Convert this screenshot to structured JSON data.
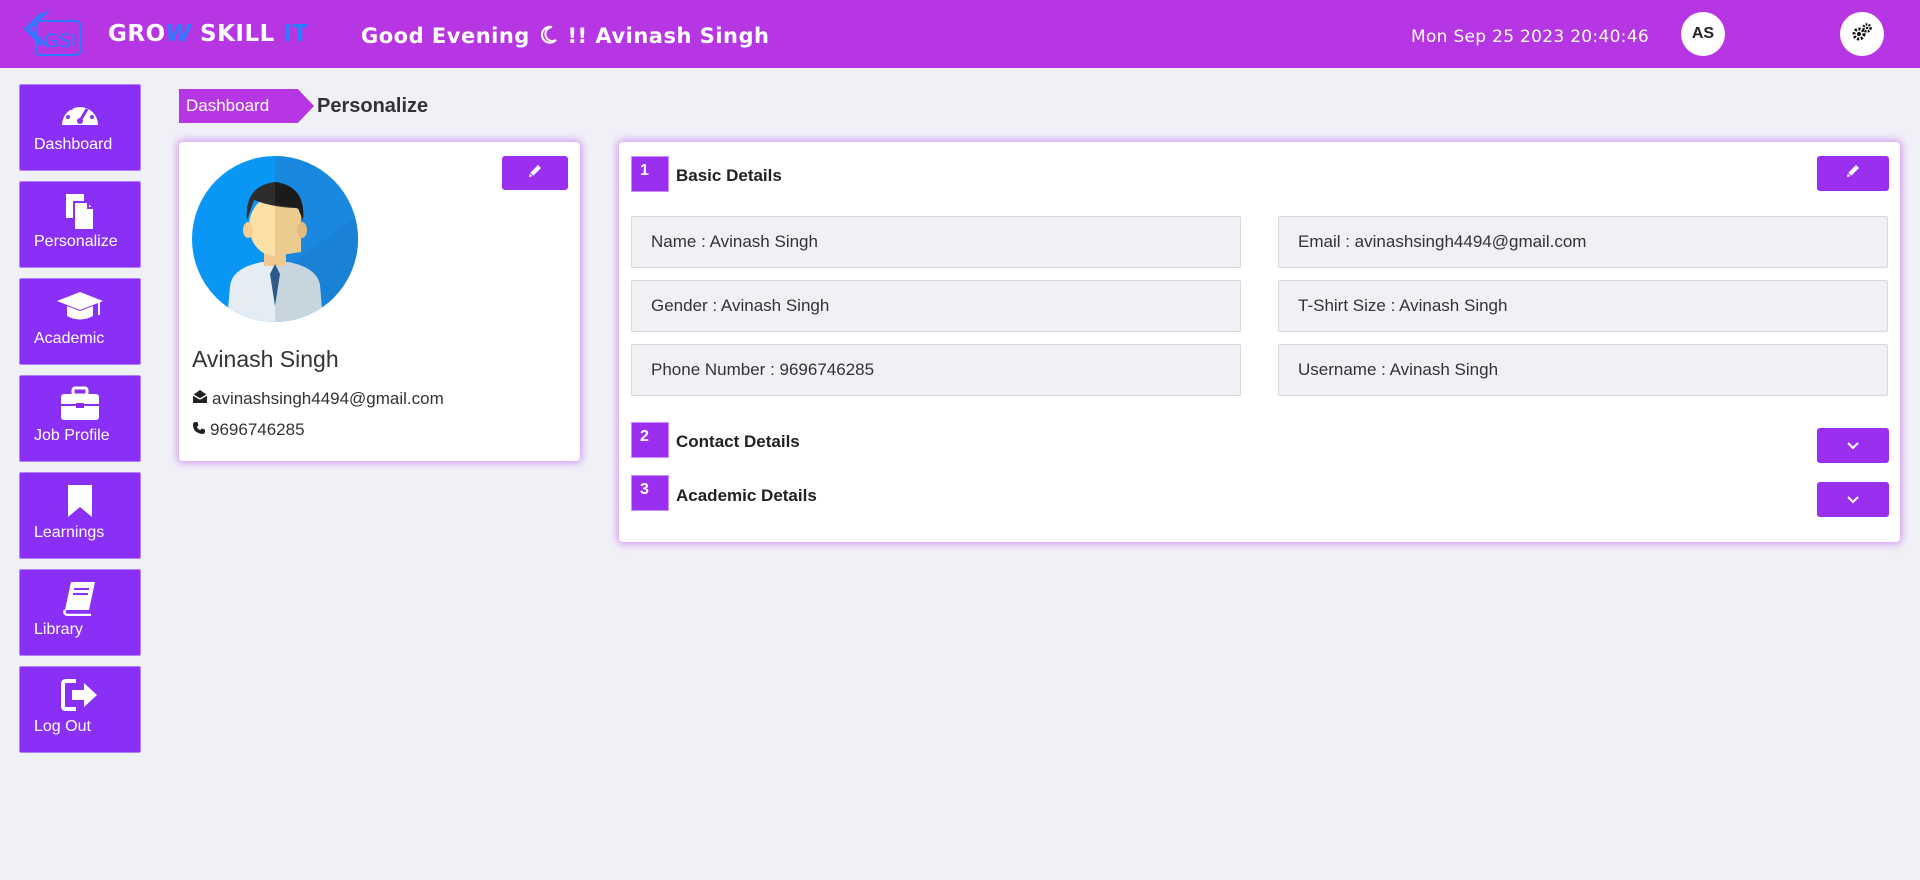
{
  "header": {
    "brand_grow": "GRO",
    "brand_w": "W",
    "brand_skill": " SKILL",
    "brand_it": " IT",
    "logo_text": "GSI",
    "greeting_prefix": "Good Evening",
    "greeting_suffix": "!! Avinash Singh",
    "datetime": "Mon Sep 25 2023 20:40:46",
    "avatar_initials": "AS",
    "bg_color": "#b536e2"
  },
  "sidebar": {
    "items": [
      {
        "label": "Dashboard",
        "icon": "speedometer-icon"
      },
      {
        "label": "Personalize",
        "icon": "documents-icon"
      },
      {
        "label": "Academic",
        "icon": "graduation-cap-icon"
      },
      {
        "label": "Job Profile",
        "icon": "briefcase-icon"
      },
      {
        "label": "Learnings",
        "icon": "bookmark-icon"
      },
      {
        "label": "Library",
        "icon": "book-icon"
      },
      {
        "label": "Log Out",
        "icon": "sign-out-icon"
      }
    ]
  },
  "breadcrumb": {
    "first": "Dashboard",
    "current": "Personalize"
  },
  "profile": {
    "name": "Avinash Singh",
    "email": "avinashsingh4494@gmail.com",
    "phone": "9696746285"
  },
  "details": {
    "sections": [
      {
        "number": "1",
        "title": "Basic Details"
      },
      {
        "number": "2",
        "title": "Contact Details"
      },
      {
        "number": "3",
        "title": "Academic Details"
      }
    ],
    "fields": {
      "name": "Name : Avinash Singh",
      "email": "Email : avinashsingh4494@gmail.com",
      "gender": "Gender : Avinash Singh",
      "tshirt": "T-Shirt Size : Avinash Singh",
      "phone": "Phone Number : 9696746285",
      "username": "Username : Avinash Singh"
    }
  },
  "colors": {
    "accent": "#9b2ff0",
    "sidebar": "#8a2ff5",
    "header": "#b536e2",
    "brand_blue": "#2d7cff"
  }
}
